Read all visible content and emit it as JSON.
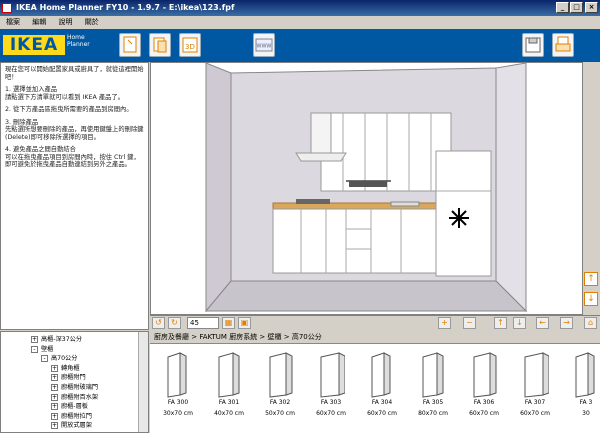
{
  "window": {
    "title": "IKEA Home Planner FY10  - 1.9.7 - E:\\ikea\\123.fpf",
    "minimize": "_",
    "maximize": "□",
    "close": "×"
  },
  "menu": [
    "檔案",
    "編輯",
    "說明",
    "關於"
  ],
  "logo": {
    "text": "IKEA",
    "sub": "Home Planner"
  },
  "toolbar": {
    "new": "新",
    "open": "開",
    "view3d": "3D",
    "web": "WWW",
    "save": "存",
    "print": "印"
  },
  "instructions": {
    "p1": "現在您可以開始配置家具或廚具了，就從這裡開始吧！",
    "p2": "1. 選擇並加入產品\n請點選下方清單就可以看到 IKEA 產品了。",
    "p3": "2. 從下方產品區拖曳所需要的產品到房間內。",
    "p4": "3. 刪除產品\n先點選所想要刪除的產品，再使用鍵盤上的刪除鍵(Delete)即可移除所選擇的項目。",
    "p5": "4. 避免產品之間自動結合\n可以在拖曳產品項目到房間內時，按住 Ctrl 鍵，即可避免於拖曳產品自動連結到另外之產品。"
  },
  "controls": {
    "zoom_value": "45"
  },
  "breadcrumb": "廚房及餐廳 > FAKTUM 廚房系統 > 壁櫃 > 高70公分",
  "tree": [
    {
      "label": "高櫃-深37公分",
      "level": 1,
      "expander": "+"
    },
    {
      "label": "壁櫃",
      "level": 1,
      "expander": "-"
    },
    {
      "label": "高70公分",
      "level": 2,
      "expander": "-"
    },
    {
      "label": "轉角櫃",
      "level": 3,
      "expander": "+"
    },
    {
      "label": "廚櫃附門",
      "level": 3,
      "expander": "+"
    },
    {
      "label": "廚櫃附玻璃門",
      "level": 3,
      "expander": "+"
    },
    {
      "label": "廚櫃附百水架",
      "level": 3,
      "expander": "+"
    },
    {
      "label": "廚櫃-層板",
      "level": 3,
      "expander": "+"
    },
    {
      "label": "廚櫃附拉門",
      "level": 3,
      "expander": "+"
    },
    {
      "label": "開放式層架",
      "level": 3,
      "expander": "+"
    }
  ],
  "products": [
    {
      "name": "FA 300",
      "size": "30x70 cm"
    },
    {
      "name": "FA 301",
      "size": "40x70 cm"
    },
    {
      "name": "FA 302",
      "size": "50x70 cm"
    },
    {
      "name": "FA 303",
      "size": "60x70 cm"
    },
    {
      "name": "FA 304",
      "size": "60x70 cm"
    },
    {
      "name": "FA 305",
      "size": "80x70 cm"
    },
    {
      "name": "FA 306",
      "size": "60x70 cm"
    },
    {
      "name": "FA 307",
      "size": "60x70 cm"
    },
    {
      "name": "FA 3",
      "size": "30"
    }
  ]
}
